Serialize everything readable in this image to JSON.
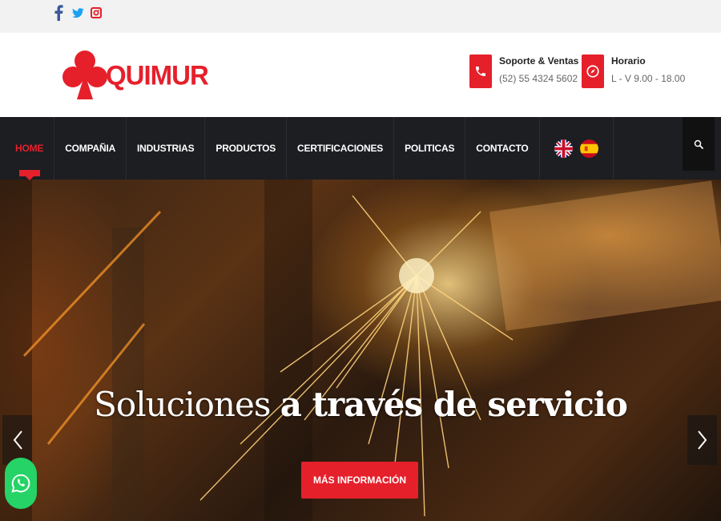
{
  "social": {
    "items": [
      {
        "name": "facebook",
        "icon": "facebook-icon",
        "color": "#3b5998"
      },
      {
        "name": "twitter",
        "icon": "twitter-icon",
        "color": "#1da1f2"
      },
      {
        "name": "instagram",
        "icon": "instagram-icon",
        "color": "#e5202b"
      }
    ]
  },
  "header": {
    "logo_text": "QUIMUR",
    "logo_icon": "club-icon",
    "contacts": [
      {
        "icon": "phone-icon",
        "title": "Soporte & Ventas",
        "value": "(52) 55 4324 5602"
      },
      {
        "icon": "compass-icon",
        "title": "Horario",
        "value": "L - V 9.00 - 18.00"
      }
    ]
  },
  "nav": {
    "items": [
      {
        "label": "HOME",
        "active": true
      },
      {
        "label": "COMPAÑIA"
      },
      {
        "label": "INDUSTRIAS"
      },
      {
        "label": "PRODUCTOS"
      },
      {
        "label": "CERTIFICACIONES"
      },
      {
        "label": "POLITICAS"
      },
      {
        "label": "CONTACTO"
      }
    ],
    "flags": [
      "uk-flag-icon",
      "spain-flag-icon"
    ],
    "search_icon": "search-icon"
  },
  "hero": {
    "title_light": "Soluciones",
    "title_bold": "a través de servicio",
    "button_label": "MÁS INFORMACIÓN",
    "prev_icon": "chevron-left-icon",
    "next_icon": "chevron-right-icon",
    "chat_icon": "whatsapp-icon"
  },
  "colors": {
    "brand": "#e5202b",
    "nav_bg": "#1c1e22",
    "topbar_bg": "#f2f2f2"
  }
}
